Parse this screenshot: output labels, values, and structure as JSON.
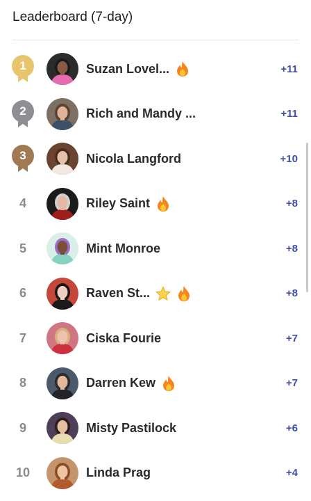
{
  "header": {
    "title": "Leaderboard (7-day)"
  },
  "colors": {
    "gold": "#e8c46d",
    "silver": "#8e8e93",
    "bronze": "#a07a52",
    "score": "#3f4fa8"
  },
  "rows": [
    {
      "rank": "1",
      "medal": "gold",
      "name": "Suzan Lovel...",
      "badges": [
        "fire-icon"
      ],
      "score": "+11",
      "avatar": {
        "bg": "#2b2b2b",
        "skin": "#8a5a44",
        "hair": "#1a1a1a",
        "top": "#e66bb0"
      }
    },
    {
      "rank": "2",
      "medal": "silver",
      "name": "Rich and Mandy ...",
      "badges": [],
      "score": "+11",
      "avatar": {
        "bg": "#7d6f62",
        "skin": "#e0b499",
        "hair": "#5a4330",
        "top": "#3c5165"
      }
    },
    {
      "rank": "3",
      "medal": "bronze",
      "name": "Nicola Langford",
      "badges": [],
      "score": "+10",
      "avatar": {
        "bg": "#6b4430",
        "skin": "#e8c2a8",
        "hair": "#4a2f20",
        "top": "#f3e8e0"
      }
    },
    {
      "rank": "4",
      "medal": "",
      "name": "Riley Saint",
      "badges": [
        "fire-icon"
      ],
      "score": "+8",
      "avatar": {
        "bg": "#1b1b1b",
        "skin": "#e5b8a5",
        "hair": "#d6d0cc",
        "top": "#9e1d1d"
      }
    },
    {
      "rank": "5",
      "medal": "",
      "name": "Mint Monroe",
      "badges": [],
      "score": "+8",
      "avatar": {
        "bg": "#d9efe8",
        "skin": "#7a4f3a",
        "hair": "#9b6dc7",
        "top": "#88d2c2"
      }
    },
    {
      "rank": "6",
      "medal": "",
      "name": "Raven St...",
      "badges": [
        "star-icon",
        "fire-icon"
      ],
      "score": "+8",
      "avatar": {
        "bg": "#c4473a",
        "skin": "#edd0c2",
        "hair": "#1c1414",
        "top": "#1a1a1a"
      }
    },
    {
      "rank": "7",
      "medal": "",
      "name": "Ciska Fourie",
      "badges": [],
      "score": "+7",
      "avatar": {
        "bg": "#d17582",
        "skin": "#ecc4ad",
        "hair": "#d9b07f",
        "top": "#cf3040"
      }
    },
    {
      "rank": "8",
      "medal": "",
      "name": "Darren Kew",
      "badges": [
        "fire-icon"
      ],
      "score": "+7",
      "avatar": {
        "bg": "#4b5a6b",
        "skin": "#e3b99c",
        "hair": "#2a2a2a",
        "top": "#22242a"
      }
    },
    {
      "rank": "9",
      "medal": "",
      "name": "Misty Pastilock",
      "badges": [],
      "score": "+6",
      "avatar": {
        "bg": "#4d3f57",
        "skin": "#e6bfa3",
        "hair": "#2b1e1a",
        "top": "#e9dcb0"
      }
    },
    {
      "rank": "10",
      "medal": "",
      "name": "Linda Prag",
      "badges": [],
      "score": "+4",
      "avatar": {
        "bg": "#c6946b",
        "skin": "#efc6a4",
        "hair": "#8a4d26",
        "top": "#b05a2d"
      }
    }
  ]
}
